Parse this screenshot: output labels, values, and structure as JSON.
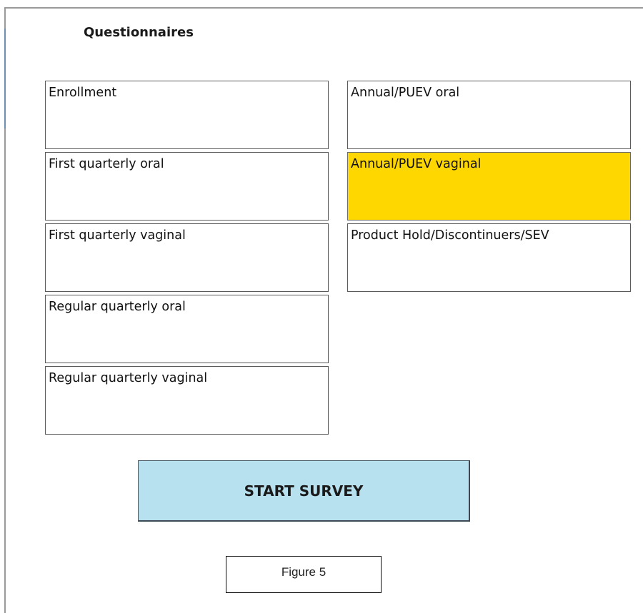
{
  "header": {
    "title": "Questionnaires"
  },
  "questionnaires": {
    "left_column": [
      {
        "label": "Enrollment",
        "selected": false
      },
      {
        "label": "First quarterly oral",
        "selected": false
      },
      {
        "label": "First quarterly vaginal",
        "selected": false
      },
      {
        "label": "Regular quarterly oral",
        "selected": false
      },
      {
        "label": "Regular quarterly vaginal",
        "selected": false
      }
    ],
    "right_column": [
      {
        "label": "Annual/PUEV oral",
        "selected": false
      },
      {
        "label": "Annual/PUEV vaginal",
        "selected": true
      },
      {
        "label": "Product Hold/Discontinuers/SEV",
        "selected": false
      }
    ]
  },
  "actions": {
    "start_label": "START SURVEY"
  },
  "caption": {
    "text": "Figure 5"
  },
  "colors": {
    "selected_background": "#ffd700",
    "start_button_background": "#b8e1ef",
    "option_border": "#5a5a5a"
  }
}
